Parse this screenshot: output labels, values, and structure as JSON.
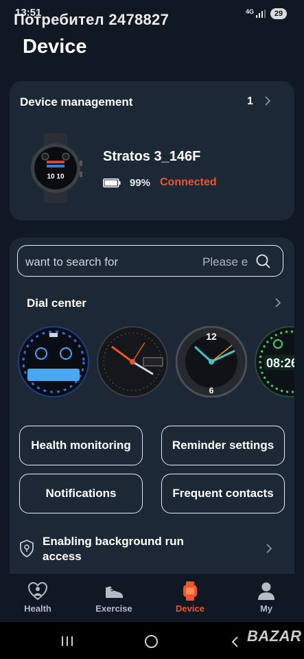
{
  "status_bar": {
    "time": "13:51",
    "network": "4G",
    "battery": "29"
  },
  "watermark": {
    "user": "Потребител 2478827",
    "site": "BAZAR"
  },
  "page": {
    "title": "Device"
  },
  "device_card": {
    "title": "Device management",
    "count": "1",
    "device_name": "Stratos 3_146F",
    "battery_percent": "99%",
    "battery_level": 0.99,
    "status": "Connected"
  },
  "search": {
    "text": "want to search for",
    "placeholder": "Please e"
  },
  "dial_center": {
    "title": "Dial center"
  },
  "buttons": {
    "health_monitoring": "Health monitoring",
    "reminder_settings": "Reminder settings",
    "notifications": "Notifications",
    "frequent_contacts": "Frequent contacts"
  },
  "background_access": {
    "label": "Enabling background run access"
  },
  "bottom_nav": [
    {
      "label": "Health",
      "icon": "heart-person-icon"
    },
    {
      "label": "Exercise",
      "icon": "sneaker-icon"
    },
    {
      "label": "Device",
      "icon": "watch-icon"
    },
    {
      "label": "My",
      "icon": "person-icon"
    }
  ],
  "colors": {
    "accent": "#f0542a",
    "background": "#0f1823",
    "card": "#1c2836"
  }
}
